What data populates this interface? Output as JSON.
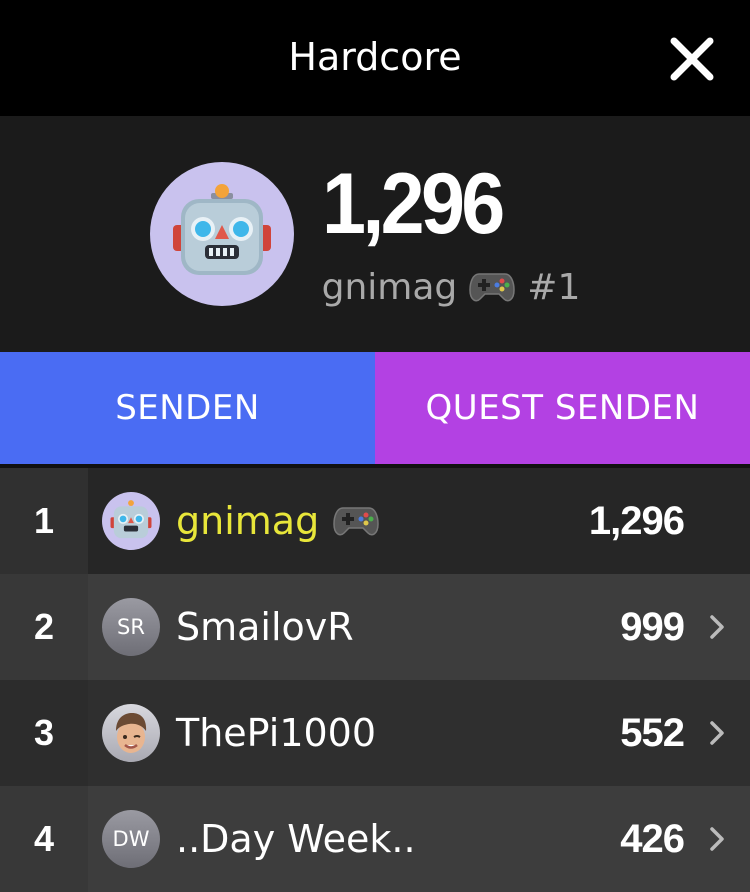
{
  "header": {
    "title": "Hardcore"
  },
  "hero": {
    "score": "1,296",
    "username": "gnimag",
    "rank_label": "#1",
    "avatar_icon": "robot-emoji-icon",
    "badge_icon": "gamepad-icon"
  },
  "actions": {
    "send_label": "SENDEN",
    "quest_label": "QUEST SENDEN"
  },
  "colors": {
    "send": "#4a6cf3",
    "quest": "#b341e3",
    "highlight": "#e8e63a"
  },
  "leaderboard": [
    {
      "rank": "1",
      "name": "gnimag",
      "score": "1,296",
      "avatar": "robot-emoji-icon"
    },
    {
      "rank": "2",
      "name": "SmailovR",
      "score": "999",
      "avatar_initials": "SR"
    },
    {
      "rank": "3",
      "name": "ThePi1000",
      "score": "552",
      "avatar": "memoji-icon"
    },
    {
      "rank": "4",
      "name": "..Day Week..",
      "score": "426",
      "avatar_initials": "DW"
    }
  ]
}
